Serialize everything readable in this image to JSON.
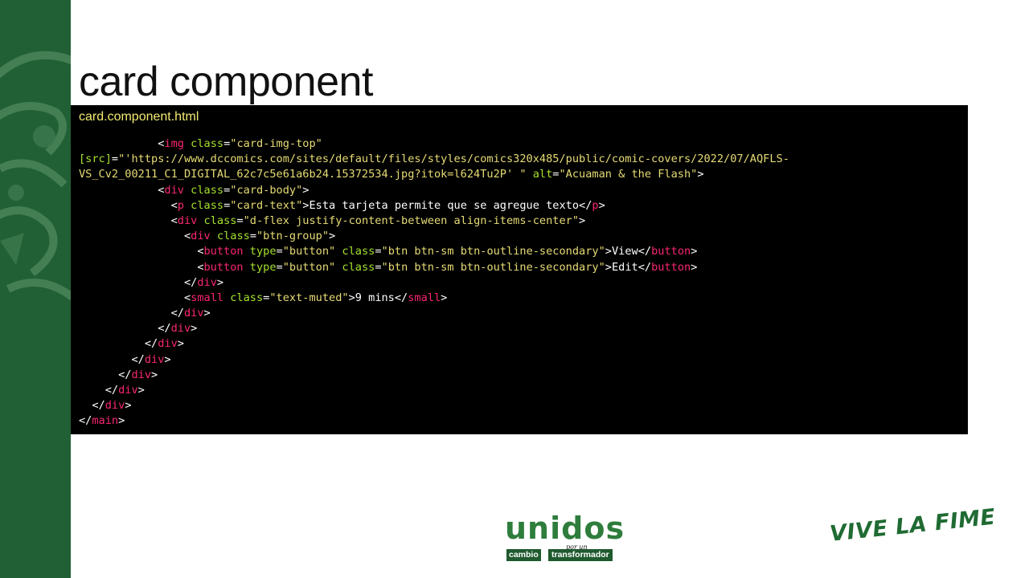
{
  "slide": {
    "title": "card component"
  },
  "code_panel": {
    "filename": "card.component.html",
    "lines": [
      [
        {
          "t": "plain",
          "v": "            "
        },
        {
          "t": "plain",
          "v": "<"
        },
        {
          "t": "tag",
          "v": "img"
        },
        {
          "t": "plain",
          "v": " "
        },
        {
          "t": "attr",
          "v": "class"
        },
        {
          "t": "plain",
          "v": "="
        },
        {
          "t": "str",
          "v": "\"card-img-top\""
        }
      ],
      [
        {
          "t": "attr",
          "v": "[src]"
        },
        {
          "t": "plain",
          "v": "="
        },
        {
          "t": "str",
          "v": "\"'https://www.dccomics.com/sites/default/files/styles/comics320x485/public/comic-covers/2022/07/AQFLS-"
        }
      ],
      [
        {
          "t": "str",
          "v": "VS_Cv2_00211_C1_DIGITAL_62c7c5e61a6b24.15372534.jpg?itok=l624Tu2P' \""
        },
        {
          "t": "plain",
          "v": " "
        },
        {
          "t": "attr",
          "v": "alt"
        },
        {
          "t": "plain",
          "v": "="
        },
        {
          "t": "str",
          "v": "\"Acuaman & the Flash\""
        },
        {
          "t": "plain",
          "v": ">"
        }
      ],
      [
        {
          "t": "plain",
          "v": "            <"
        },
        {
          "t": "tag",
          "v": "div"
        },
        {
          "t": "plain",
          "v": " "
        },
        {
          "t": "attr",
          "v": "class"
        },
        {
          "t": "plain",
          "v": "="
        },
        {
          "t": "str",
          "v": "\"card-body\""
        },
        {
          "t": "plain",
          "v": ">"
        }
      ],
      [
        {
          "t": "plain",
          "v": "              <"
        },
        {
          "t": "tag",
          "v": "p"
        },
        {
          "t": "plain",
          "v": " "
        },
        {
          "t": "attr",
          "v": "class"
        },
        {
          "t": "plain",
          "v": "="
        },
        {
          "t": "str",
          "v": "\"card-text\""
        },
        {
          "t": "plain",
          "v": ">Esta tarjeta permite que se agregue texto</"
        },
        {
          "t": "tag",
          "v": "p"
        },
        {
          "t": "plain",
          "v": ">"
        }
      ],
      [
        {
          "t": "plain",
          "v": "              <"
        },
        {
          "t": "tag",
          "v": "div"
        },
        {
          "t": "plain",
          "v": " "
        },
        {
          "t": "attr",
          "v": "class"
        },
        {
          "t": "plain",
          "v": "="
        },
        {
          "t": "str",
          "v": "\"d-flex justify-content-between align-items-center\""
        },
        {
          "t": "plain",
          "v": ">"
        }
      ],
      [
        {
          "t": "plain",
          "v": "                <"
        },
        {
          "t": "tag",
          "v": "div"
        },
        {
          "t": "plain",
          "v": " "
        },
        {
          "t": "attr",
          "v": "class"
        },
        {
          "t": "plain",
          "v": "="
        },
        {
          "t": "str",
          "v": "\"btn-group\""
        },
        {
          "t": "plain",
          "v": ">"
        }
      ],
      [
        {
          "t": "plain",
          "v": "                  <"
        },
        {
          "t": "tag",
          "v": "button"
        },
        {
          "t": "plain",
          "v": " "
        },
        {
          "t": "attr",
          "v": "type"
        },
        {
          "t": "plain",
          "v": "="
        },
        {
          "t": "str",
          "v": "\"button\""
        },
        {
          "t": "plain",
          "v": " "
        },
        {
          "t": "attr",
          "v": "class"
        },
        {
          "t": "plain",
          "v": "="
        },
        {
          "t": "str",
          "v": "\"btn btn-sm btn-outline-secondary\""
        },
        {
          "t": "plain",
          "v": ">View</"
        },
        {
          "t": "tag",
          "v": "button"
        },
        {
          "t": "plain",
          "v": ">"
        }
      ],
      [
        {
          "t": "plain",
          "v": "                  <"
        },
        {
          "t": "tag",
          "v": "button"
        },
        {
          "t": "plain",
          "v": " "
        },
        {
          "t": "attr",
          "v": "type"
        },
        {
          "t": "plain",
          "v": "="
        },
        {
          "t": "str",
          "v": "\"button\""
        },
        {
          "t": "plain",
          "v": " "
        },
        {
          "t": "attr",
          "v": "class"
        },
        {
          "t": "plain",
          "v": "="
        },
        {
          "t": "str",
          "v": "\"btn btn-sm btn-outline-secondary\""
        },
        {
          "t": "plain",
          "v": ">Edit</"
        },
        {
          "t": "tag",
          "v": "button"
        },
        {
          "t": "plain",
          "v": ">"
        }
      ],
      [
        {
          "t": "plain",
          "v": "                </"
        },
        {
          "t": "tag",
          "v": "div"
        },
        {
          "t": "plain",
          "v": ">"
        }
      ],
      [
        {
          "t": "plain",
          "v": "                <"
        },
        {
          "t": "tag",
          "v": "small"
        },
        {
          "t": "plain",
          "v": " "
        },
        {
          "t": "attr",
          "v": "class"
        },
        {
          "t": "plain",
          "v": "="
        },
        {
          "t": "str",
          "v": "\"text-muted\""
        },
        {
          "t": "plain",
          "v": ">9 mins</"
        },
        {
          "t": "tag",
          "v": "small"
        },
        {
          "t": "plain",
          "v": ">"
        }
      ],
      [
        {
          "t": "plain",
          "v": "              </"
        },
        {
          "t": "tag",
          "v": "div"
        },
        {
          "t": "plain",
          "v": ">"
        }
      ],
      [
        {
          "t": "plain",
          "v": "            </"
        },
        {
          "t": "tag",
          "v": "div"
        },
        {
          "t": "plain",
          "v": ">"
        }
      ],
      [
        {
          "t": "plain",
          "v": "          </"
        },
        {
          "t": "tag",
          "v": "div"
        },
        {
          "t": "plain",
          "v": ">"
        }
      ],
      [
        {
          "t": "plain",
          "v": "        </"
        },
        {
          "t": "tag",
          "v": "div"
        },
        {
          "t": "plain",
          "v": ">"
        }
      ],
      [
        {
          "t": "plain",
          "v": "      </"
        },
        {
          "t": "tag",
          "v": "div"
        },
        {
          "t": "plain",
          "v": ">"
        }
      ],
      [
        {
          "t": "plain",
          "v": "    </"
        },
        {
          "t": "tag",
          "v": "div"
        },
        {
          "t": "plain",
          "v": ">"
        }
      ],
      [
        {
          "t": "plain",
          "v": "  </"
        },
        {
          "t": "tag",
          "v": "div"
        },
        {
          "t": "plain",
          "v": ">"
        }
      ],
      [
        {
          "t": "plain",
          "v": "</"
        },
        {
          "t": "tag",
          "v": "main"
        },
        {
          "t": "plain",
          "v": ">"
        }
      ]
    ]
  },
  "footer": {
    "logo_unidos": {
      "word": "unidos",
      "por_un": "por un",
      "cambio": "cambio",
      "transformador": "transformador"
    },
    "slogan": "VIVE LA FIME"
  },
  "colors": {
    "sidebar": "#215f35",
    "code_background": "#000000",
    "filename": "#f3ea6f",
    "tag": "#f92672",
    "attribute": "#a6e22e",
    "string": "#e6db74"
  },
  "icons": {
    "sidebar_art": "tiger-mascot-icon"
  }
}
